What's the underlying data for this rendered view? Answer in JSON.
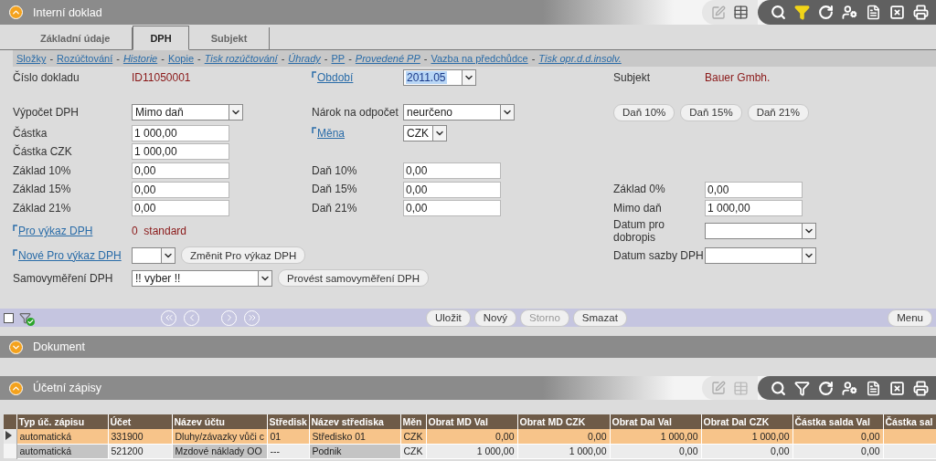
{
  "main_panel": {
    "title": "Interní doklad",
    "expanded": true,
    "toolbar": {
      "table_view_enabled": true,
      "filter_active": true
    }
  },
  "tabs": [
    {
      "label": "Základní údaje",
      "selected": false
    },
    {
      "label": "DPH",
      "selected": true
    },
    {
      "label": "Subjekt",
      "selected": false
    }
  ],
  "links": {
    "separator": "-",
    "items": [
      {
        "text": "Složky",
        "italic": false
      },
      {
        "text": "Rozúčtování",
        "italic": false
      },
      {
        "text": "Historie",
        "italic": true
      },
      {
        "text": "Kopie",
        "italic": false
      },
      {
        "text": "Tisk rozúčtování",
        "italic": true
      },
      {
        "text": "Úhrady",
        "italic": true
      },
      {
        "text": "PP",
        "italic": false
      },
      {
        "text": "Provedené PP",
        "italic": true
      },
      {
        "text": "Vazba na předchůdce",
        "italic": false
      },
      {
        "text": "Tisk opr.d.d.insolv.",
        "italic": true
      }
    ]
  },
  "form_rows": [
    {
      "left": {
        "label": {
          "kind": "text",
          "text": "Číslo dokladu"
        },
        "controls": [
          {
            "kind": "value",
            "value": "ID11050001"
          }
        ]
      },
      "middle": {
        "label": {
          "kind": "link",
          "text": "Období"
        },
        "controls": [
          {
            "kind": "short-select",
            "value": "2011.05",
            "highlighted": true
          }
        ]
      },
      "right": {
        "label": {
          "kind": "text",
          "text": "Subjekt"
        },
        "controls": [
          {
            "kind": "value",
            "value": "Bauer Gmbh."
          }
        ]
      }
    },
    {
      "left": {
        "label": {
          "kind": "text",
          "text": "Výpočet DPH"
        },
        "controls": [
          {
            "kind": "select",
            "value": "Mimo daň"
          }
        ]
      },
      "middle": {
        "label": {
          "kind": "text",
          "text": "Nárok na odpočet"
        },
        "controls": [
          {
            "kind": "select",
            "value": "neurčeno"
          }
        ]
      },
      "right": {
        "controls": [
          {
            "kind": "button",
            "value": "Daň 10%"
          },
          {
            "kind": "button",
            "value": "Daň 15%"
          },
          {
            "kind": "button",
            "value": "Daň 21%"
          }
        ]
      }
    },
    {
      "left": {
        "label": {
          "kind": "text",
          "text": "Částka"
        },
        "controls": [
          {
            "kind": "input",
            "value": "1 000,00"
          }
        ]
      },
      "middle": {
        "label": {
          "kind": "link",
          "text": "Měna"
        },
        "controls": [
          {
            "kind": "narrow-select",
            "value": "CZK"
          }
        ]
      }
    },
    {
      "left": {
        "label": {
          "kind": "text",
          "text": "Částka CZK"
        },
        "controls": [
          {
            "kind": "input",
            "value": "1 000,00"
          }
        ]
      }
    },
    {
      "left": {
        "label": {
          "kind": "text",
          "text": "Základ 10%"
        },
        "controls": [
          {
            "kind": "input",
            "value": "0,00"
          }
        ]
      },
      "middle": {
        "label": {
          "kind": "text",
          "text": "Daň 10%"
        },
        "controls": [
          {
            "kind": "input",
            "value": "0,00"
          }
        ]
      }
    },
    {
      "left": {
        "label": {
          "kind": "text",
          "text": "Základ 15%"
        },
        "controls": [
          {
            "kind": "input",
            "value": "0,00"
          }
        ]
      },
      "middle": {
        "label": {
          "kind": "text",
          "text": "Daň 15%"
        },
        "controls": [
          {
            "kind": "input",
            "value": "0,00"
          }
        ]
      },
      "right": {
        "label": {
          "kind": "text",
          "text": "Základ 0%"
        },
        "controls": [
          {
            "kind": "input",
            "value": "0,00"
          }
        ]
      }
    },
    {
      "left": {
        "label": {
          "kind": "text",
          "text": "Základ 21%"
        },
        "controls": [
          {
            "kind": "input",
            "value": "0,00"
          }
        ]
      },
      "middle": {
        "label": {
          "kind": "text",
          "text": "Daň 21%"
        },
        "controls": [
          {
            "kind": "input",
            "value": "0,00"
          }
        ]
      },
      "right": {
        "label": {
          "kind": "text",
          "text": "Mimo daň"
        },
        "controls": [
          {
            "kind": "input",
            "value": "1 000,00"
          }
        ]
      }
    },
    {
      "left": {
        "label": {
          "kind": "link",
          "text": "Pro výkaz DPH"
        },
        "controls": [
          {
            "kind": "value",
            "value": "0  standard"
          }
        ]
      },
      "right": {
        "label": {
          "kind": "text",
          "text": "Datum pro dobropis"
        },
        "controls": [
          {
            "kind": "select"
          }
        ]
      }
    },
    {
      "left": {
        "label": {
          "kind": "link",
          "text": "Nové Pro výkaz DPH"
        },
        "controls": [
          {
            "kind": "narrow-select"
          },
          {
            "kind": "button",
            "value": "Změnit Pro výkaz DPH"
          }
        ]
      },
      "right": {
        "label": {
          "kind": "text",
          "text": "Datum sazby DPH"
        },
        "controls": [
          {
            "kind": "select"
          }
        ]
      }
    },
    {
      "left": {
        "label": {
          "kind": "text",
          "text": "Samovyměření DPH"
        },
        "controls": [
          {
            "kind": "wide-select",
            "value": "!! vyber !!"
          },
          {
            "kind": "button",
            "value": "Provést samovyměření DPH"
          }
        ]
      }
    }
  ],
  "action_bar": {
    "checked": false,
    "buttons": [
      {
        "label": "Uložit",
        "disabled": false
      },
      {
        "label": "Nový",
        "disabled": false
      },
      {
        "label": "Storno",
        "disabled": true
      },
      {
        "label": "Smazat",
        "disabled": false
      }
    ],
    "menu": "Menu"
  },
  "document_panel": {
    "title": "Dokument",
    "expanded": false
  },
  "entries_panel": {
    "title": "Účetní zápisy",
    "expanded": true,
    "toolbar": {
      "table_view_enabled": false,
      "filter_active": false
    }
  },
  "table": {
    "columns": [
      {
        "label": "Typ úč. zápisu",
        "kind": "text",
        "shaded": true
      },
      {
        "label": "Účet",
        "kind": "text",
        "shaded": false
      },
      {
        "label": "Název účtu",
        "kind": "text",
        "shaded": true
      },
      {
        "label": "Středisk",
        "kind": "text",
        "shaded": false
      },
      {
        "label": "Název střediska",
        "kind": "text",
        "shaded": true
      },
      {
        "label": "Měn",
        "kind": "text",
        "shaded": false
      },
      {
        "label": "Obrat MD Val",
        "kind": "amount",
        "shaded": false
      },
      {
        "label": "Obrat MD CZK",
        "kind": "amount",
        "shaded": false
      },
      {
        "label": "Obrat Dal Val",
        "kind": "amount",
        "shaded": false
      },
      {
        "label": "Obrat Dal CZK",
        "kind": "amount",
        "shaded": false
      },
      {
        "label": "Částka salda Val",
        "kind": "amount",
        "shaded": false
      },
      {
        "label": "Částka sal",
        "kind": "amount",
        "shaded": false
      }
    ],
    "rows": [
      {
        "selected": true,
        "cells": [
          "automatická",
          "331900",
          "Dluhy/závazky vůči c",
          "01",
          "Středisko 01",
          "CZK",
          "0,00",
          "0,00",
          "1 000,00",
          "1 000,00",
          "0,00"
        ]
      },
      {
        "selected": false,
        "cells": [
          "automatická",
          "521200",
          "Mzdové náklady OO",
          "---",
          "Podnik",
          "CZK",
          "1 000,00",
          "1 000,00",
          "0,00",
          "0,00",
          "0,00"
        ]
      }
    ]
  }
}
